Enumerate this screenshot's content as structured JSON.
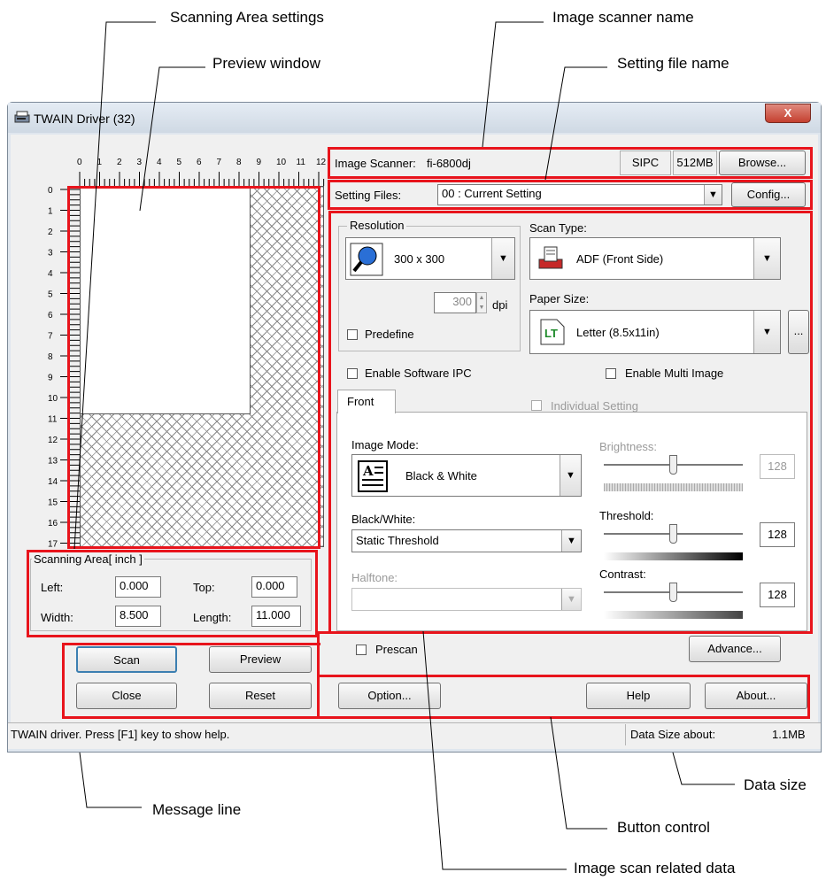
{
  "callouts": {
    "scanning_area_settings": "Scanning Area settings",
    "image_scanner_name": "Image scanner name",
    "preview_window": "Preview window",
    "setting_file_name": "Setting file name",
    "message_line": "Message line",
    "data_size": "Data size",
    "button_control": "Button control",
    "image_scan_related_data": "Image scan related data"
  },
  "window": {
    "title": "TWAIN Driver (32)",
    "close_glyph": "X"
  },
  "ruler": {
    "top_numbers": [
      "0",
      "1",
      "2",
      "3",
      "4",
      "5",
      "6",
      "7",
      "8",
      "9",
      "10",
      "11",
      "12"
    ],
    "left_numbers": [
      "0",
      "1",
      "2",
      "3",
      "4",
      "5",
      "6",
      "7",
      "8",
      "9",
      "10",
      "11",
      "12",
      "13",
      "14",
      "15",
      "16",
      "17"
    ]
  },
  "scanning_area": {
    "legend": "Scanning Area[ inch ]",
    "left_label": "Left:",
    "left_value": "0.000",
    "top_label": "Top:",
    "top_value": "0.000",
    "width_label": "Width:",
    "width_value": "8.500",
    "length_label": "Length:",
    "length_value": "11.000"
  },
  "scanner": {
    "label": "Image Scanner:",
    "name": "fi-6800dj",
    "ipc": "SIPC",
    "memory": "512MB",
    "browse": "Browse..."
  },
  "setting_files": {
    "label": "Setting Files:",
    "value": "00 : Current Setting",
    "config": "Config..."
  },
  "resolution": {
    "legend": "Resolution",
    "value": "300 x 300",
    "custom_value": "300",
    "unit": "dpi",
    "predefine": "Predefine"
  },
  "scan_type": {
    "label": "Scan Type:",
    "value": "ADF (Front Side)"
  },
  "paper_size": {
    "label": "Paper Size:",
    "value": "Letter (8.5x11in)",
    "more": "...",
    "badge": "LT"
  },
  "options": {
    "enable_software_ipc": "Enable Software IPC",
    "enable_multi_image": "Enable Multi Image",
    "individual_setting": "Individual Setting"
  },
  "front_tab": {
    "label": "Front"
  },
  "image_mode": {
    "label": "Image Mode:",
    "value": "Black & White"
  },
  "black_white": {
    "label": "Black/White:",
    "value": "Static Threshold"
  },
  "halftone": {
    "label": "Halftone:",
    "value": ""
  },
  "brightness": {
    "label": "Brightness:",
    "value": "128"
  },
  "threshold": {
    "label": "Threshold:",
    "value": "128"
  },
  "contrast": {
    "label": "Contrast:",
    "value": "128"
  },
  "prescan": {
    "label": "Prescan"
  },
  "buttons": {
    "advance": "Advance...",
    "scan": "Scan",
    "preview": "Preview",
    "close": "Close",
    "reset": "Reset",
    "option": "Option...",
    "help": "Help",
    "about": "About..."
  },
  "status": {
    "message": "TWAIN driver. Press [F1] key to show help.",
    "data_size_label": "Data Size about:",
    "data_size_value": "1.1MB"
  },
  "colors": {
    "annotation_red": "#e8141c",
    "window_bg": "#dfe6ee",
    "panel_bg": "#f0f0f0",
    "close_button": "#c8453a"
  }
}
